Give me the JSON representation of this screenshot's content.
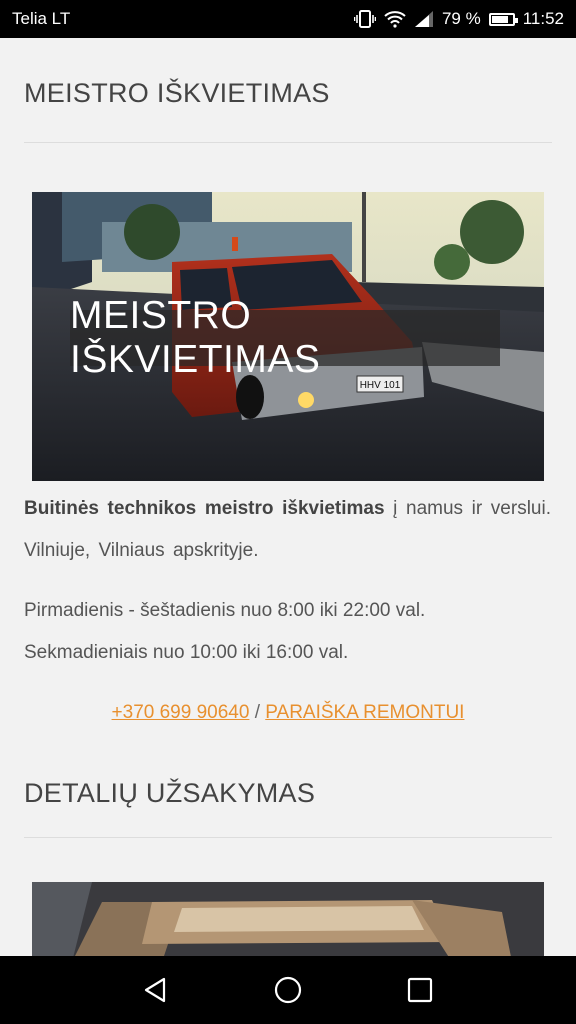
{
  "status_bar": {
    "carrier": "Telia LT",
    "battery_percent": "79 %",
    "battery_level": 0.79,
    "time": "11:52",
    "icons": [
      "vibrate-icon",
      "wifi-icon",
      "signal-icon",
      "battery-icon"
    ]
  },
  "section1": {
    "title": "MEISTRO IŠKVIETIMAS",
    "hero_overlay": "MEISTRO IŠKVIETIMAS",
    "plate": "HHV 101",
    "intro_bold": "Buitinės technikos meistro iškvietimas",
    "intro_rest": " į namus ir verslui. Vilniuje, Vilniaus apskrityje.",
    "hours_line1": "Pirmadienis - šeštadienis nuo 8:00 iki 22:00 val.",
    "hours_line2": "Sekmadieniais nuo 10:00 iki 16:00 val.",
    "phone_link": "+370 699 90640",
    "separator": " / ",
    "repair_link": "PARAIŠKA REMONTUI"
  },
  "section2": {
    "title": "DETALIŲ UŽSAKYMAS"
  },
  "colors": {
    "link": "#e8902f",
    "background": "#f2f2f2",
    "text": "#555555"
  }
}
